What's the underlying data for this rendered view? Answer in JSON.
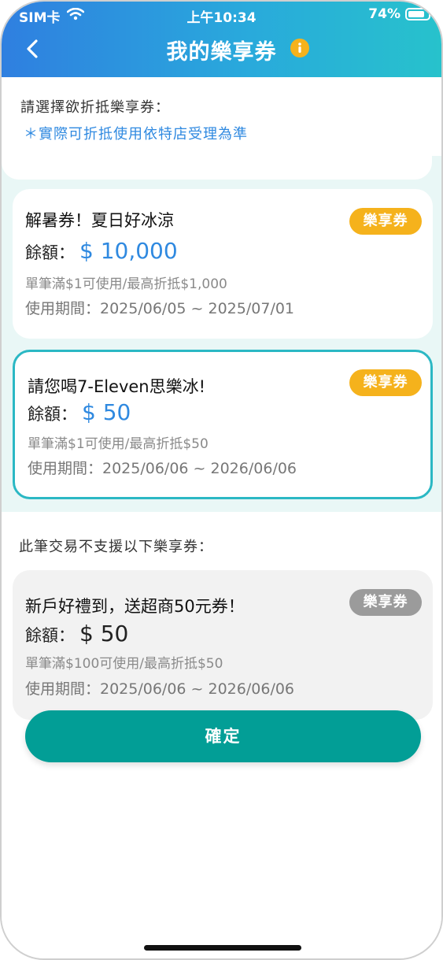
{
  "status_bar": {
    "carrier": "SIM卡",
    "time": "上午10:34",
    "battery": "74%"
  },
  "nav": {
    "title": "我的樂享券"
  },
  "hint": {
    "label": "請選擇欲折抵樂享券：",
    "note": "＊實際可折抵使用依特店受理為準"
  },
  "colors": {
    "header_start": "#2f7fe0",
    "header_end": "#27c2cc",
    "accent_blue": "#2f89e0",
    "badge_active": "#f5b21c",
    "badge_disabled": "#9b9b9b",
    "selected_border": "#2bb8c4",
    "confirm_button": "#029e96"
  },
  "vouchers": [
    {
      "title": "解暑券！夏日好冰涼",
      "badge": "樂享券",
      "balance_label": "餘額：",
      "balance": "$ 10,000",
      "rule": "單筆滿$1可使用/最高折抵$1,000",
      "period": "使用期間：2025/06/05 ~ 2025/07/01"
    },
    {
      "title": "請您喝7-Eleven思樂冰!",
      "badge": "樂享券",
      "balance_label": "餘額：",
      "balance": "$ 50",
      "rule": "單筆滿$1可使用/最高折抵$50",
      "period": "使用期間：2025/06/06 ~ 2026/06/06"
    }
  ],
  "unsupported": {
    "label": "此筆交易不支援以下樂享券：",
    "voucher": {
      "title": "新戶好禮到，送超商50元券！",
      "badge": "樂享券",
      "balance_label": "餘額：",
      "balance": "$ 50",
      "rule": "單筆滿$100可使用/最高折抵$50",
      "period": "使用期間：2025/06/06 ~ 2026/06/06"
    }
  },
  "confirm_label": "確定"
}
